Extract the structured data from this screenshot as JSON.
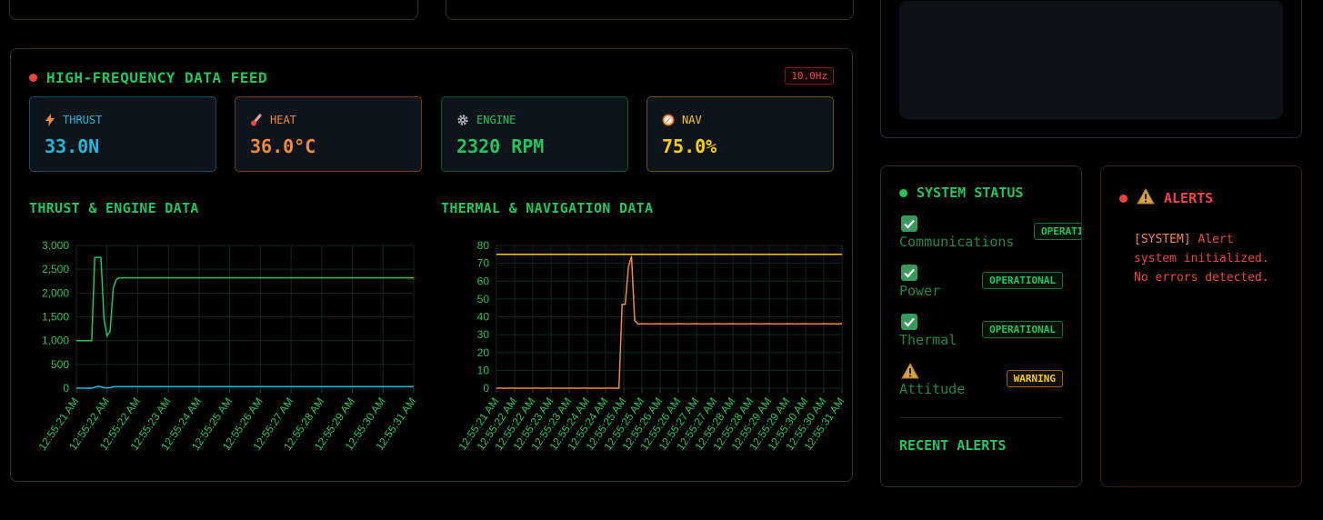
{
  "feed": {
    "title": "HIGH-FREQUENCY DATA FEED",
    "rate": "10.0Hz",
    "metrics": {
      "thrust": {
        "label": "THRUST",
        "value": "33.0N",
        "icon": "lightning-icon",
        "color": "#22b7d8"
      },
      "heat": {
        "label": "HEAT",
        "value": "36.0°C",
        "icon": "thermometer-icon",
        "color": "#f08a3c"
      },
      "engine": {
        "label": "ENGINE",
        "value": "2320 RPM",
        "icon": "gear-icon",
        "color": "#22c55e"
      },
      "nav": {
        "label": "NAV",
        "value": "75.0%",
        "icon": "compass-icon",
        "color": "#facc15"
      }
    }
  },
  "chart_data": [
    {
      "type": "line",
      "title": "THRUST & ENGINE DATA",
      "x": [
        "12:55:21 AM",
        "12:55:22 AM",
        "12:55:22 AM",
        "12:55:23 AM",
        "12:55:24 AM",
        "12:55:25 AM",
        "12:55:26 AM",
        "12:55:27 AM",
        "12:55:28 AM",
        "12:55:29 AM",
        "12:55:30 AM",
        "12:55:31 AM"
      ],
      "ylim": [
        0,
        3000
      ],
      "yticks": [
        "3,000",
        "2,500",
        "2,000",
        "1,500",
        "1,000",
        "500",
        "0"
      ],
      "series": [
        {
          "color": "#22c55e",
          "values": [
            1000,
            1000,
            1000,
            1000,
            1000,
            1000,
            2750,
            2750,
            2750,
            1450,
            1100,
            1200,
            2100,
            2280,
            2320,
            2320,
            2320,
            2320,
            2320,
            2320,
            2320,
            2320,
            2320,
            2320,
            2320,
            2320,
            2320,
            2320,
            2320,
            2320,
            2320,
            2320,
            2320,
            2320,
            2320,
            2320,
            2320,
            2320,
            2320,
            2320,
            2320,
            2320,
            2320,
            2320,
            2320,
            2320,
            2320,
            2320,
            2320,
            2320,
            2320,
            2320,
            2320,
            2320,
            2320,
            2320,
            2320,
            2320,
            2320,
            2320,
            2320,
            2320,
            2320,
            2320,
            2320,
            2320,
            2320,
            2320,
            2320,
            2320,
            2320,
            2320,
            2320,
            2320,
            2320,
            2320,
            2320,
            2320,
            2320,
            2320,
            2320,
            2320,
            2320,
            2320,
            2320,
            2320,
            2320,
            2320,
            2320,
            2320,
            2320,
            2320,
            2320,
            2320,
            2320,
            2320,
            2320,
            2320,
            2320,
            2320,
            2320,
            2320,
            2320,
            2320,
            2320,
            2320,
            2320,
            2320,
            2320,
            2320,
            2320
          ]
        },
        {
          "color": "#22b7d8",
          "values": [
            0,
            0,
            0,
            0,
            0,
            0,
            20,
            40,
            30,
            10,
            5,
            10,
            30,
            33,
            33,
            33,
            33,
            33,
            33,
            33,
            33,
            33,
            33,
            33,
            33,
            33,
            33,
            33,
            33,
            33,
            33,
            33,
            33,
            33,
            33,
            33,
            33,
            33,
            33,
            33,
            33,
            33,
            33,
            33,
            33,
            33,
            33,
            33,
            33,
            33,
            33,
            33,
            33,
            33,
            33,
            33,
            33,
            33,
            33,
            33,
            33,
            33,
            33,
            33,
            33,
            33,
            33,
            33,
            33,
            33,
            33,
            33,
            33,
            33,
            33,
            33,
            33,
            33,
            33,
            33,
            33,
            33,
            33,
            33,
            33,
            33,
            33,
            33,
            33,
            33,
            33,
            33,
            33,
            33,
            33,
            33,
            33,
            33,
            33,
            33,
            33,
            33,
            33,
            33,
            33,
            33,
            33,
            33,
            33,
            33,
            33
          ]
        }
      ]
    },
    {
      "type": "line",
      "title": "THERMAL & NAVIGATION DATA",
      "x": [
        "12:55:21 AM",
        "12:55:22 AM",
        "12:55:22 AM",
        "12:55:23 AM",
        "12:55:23 AM",
        "12:55:24 AM",
        "12:55:24 AM",
        "12:55:25 AM",
        "12:55:25 AM",
        "12:55:26 AM",
        "12:55:26 AM",
        "12:55:27 AM",
        "12:55:27 AM",
        "12:55:28 AM",
        "12:55:28 AM",
        "12:55:29 AM",
        "12:55:29 AM",
        "12:55:30 AM",
        "12:55:30 AM",
        "12:55:31 AM"
      ],
      "ylim": [
        0,
        80
      ],
      "yticks": [
        "80",
        "70",
        "60",
        "50",
        "40",
        "30",
        "20",
        "10",
        "0"
      ],
      "series": [
        {
          "color": "#facc15",
          "values": [
            75,
            75,
            75,
            75,
            75,
            75,
            75,
            75,
            75,
            75,
            75,
            75,
            75,
            75,
            75,
            75,
            75,
            75,
            75,
            75,
            75,
            75,
            75,
            75,
            75,
            75,
            75,
            75,
            75,
            75,
            75,
            75,
            75,
            75,
            75,
            75,
            75,
            75,
            75,
            75,
            75,
            75,
            75,
            75,
            75,
            75,
            75,
            75,
            75,
            75,
            75,
            75,
            75,
            75,
            75,
            75,
            75,
            75,
            75,
            75,
            75,
            75,
            75,
            75,
            75,
            75,
            75,
            75,
            75,
            75,
            75,
            75,
            75,
            75,
            75,
            75,
            75,
            75,
            75,
            75,
            75,
            75,
            75,
            75,
            75,
            75,
            75,
            75,
            75,
            75,
            75,
            75,
            75,
            75,
            75,
            75,
            75,
            75,
            75,
            75,
            75,
            75,
            75,
            75,
            75,
            75,
            75,
            75,
            75,
            75,
            75
          ]
        },
        {
          "color": "#f08a3c",
          "values": [
            0,
            0,
            0,
            0,
            0,
            0,
            0,
            0,
            0,
            0,
            0,
            0,
            0,
            0,
            0,
            0,
            0,
            0,
            0,
            0,
            0,
            0,
            0,
            0,
            0,
            0,
            0,
            0,
            0,
            0,
            0,
            0,
            0,
            0,
            0,
            0,
            0,
            0,
            0,
            0,
            47,
            47,
            68,
            74,
            38,
            36,
            36,
            36,
            36,
            36,
            36,
            36,
            36,
            36,
            36,
            36,
            36,
            36,
            36,
            36,
            36,
            36,
            36,
            36,
            36,
            36,
            36,
            36,
            36,
            36,
            36,
            36,
            36,
            36,
            36,
            36,
            36,
            36,
            36,
            36,
            36,
            36,
            36,
            36,
            36,
            36,
            36,
            36,
            36,
            36,
            36,
            36,
            36,
            36,
            36,
            36,
            36,
            36,
            36,
            36,
            36,
            36,
            36,
            36,
            36,
            36,
            36,
            36,
            36,
            36,
            36
          ]
        }
      ]
    }
  ],
  "status": {
    "title": "SYSTEM STATUS",
    "systems": [
      {
        "name": "Communications",
        "status": "OPERATIONAL",
        "icon": "check-icon"
      },
      {
        "name": "Power",
        "status": "OPERATIONAL",
        "icon": "check-icon"
      },
      {
        "name": "Thermal",
        "status": "OPERATIONAL",
        "icon": "check-icon"
      },
      {
        "name": "Attitude",
        "status": "WARNING",
        "icon": "warning-icon"
      }
    ],
    "recent_alerts_title": "RECENT ALERTS"
  },
  "alerts": {
    "title": "ALERTS",
    "tag": "[SYSTEM]",
    "message": " Alert system initialized. No errors detected."
  }
}
